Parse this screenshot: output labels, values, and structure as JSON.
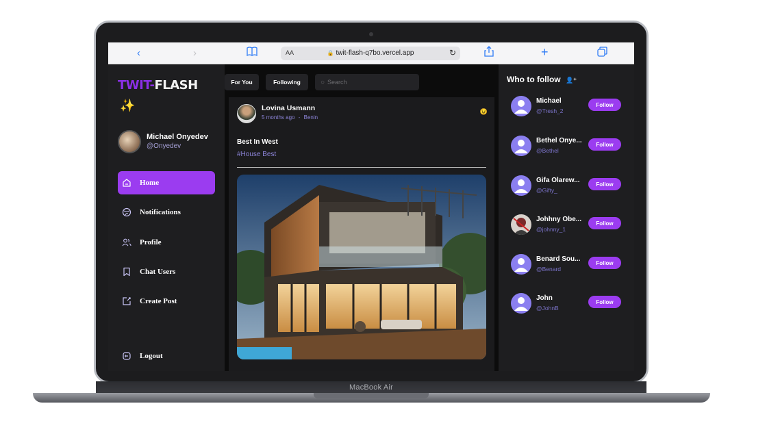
{
  "device": {
    "label": "MacBook Air"
  },
  "browser": {
    "text_size": "AA",
    "url": "twit-flash-q7bo.vercel.app"
  },
  "sidebar": {
    "logo_part1": "TWIT-",
    "logo_part2": "FLASH",
    "sparkle": "✨",
    "profile": {
      "name": "Michael Onyedev",
      "handle": "@Onyedev"
    },
    "nav": [
      {
        "label": "Home",
        "icon": "home-icon",
        "active": true
      },
      {
        "label": "Notifications",
        "icon": "globe-icon"
      },
      {
        "label": "Profile",
        "icon": "users-icon"
      },
      {
        "label": "Chat Users",
        "icon": "bookmark-icon"
      },
      {
        "label": "Create Post",
        "icon": "create-icon"
      }
    ],
    "logout": "Logout"
  },
  "main": {
    "tabs": [
      "For You",
      "Following"
    ],
    "search_placeholder": "Search",
    "post": {
      "author": "Lovina Usmann",
      "time": "5 months ago",
      "location": "Benin",
      "meta_separator": "-",
      "emoji": "😉",
      "text": "Best In West",
      "tag": "#House Best"
    }
  },
  "who_to_follow": {
    "title": "Who to follow",
    "follow_label": "Follow",
    "users": [
      {
        "name": "Michael",
        "handle": "@Tresh_2"
      },
      {
        "name": "Bethel Onye...",
        "handle": "@Bethel"
      },
      {
        "name": "Gifa Olarew...",
        "handle": "@Gifty_"
      },
      {
        "name": "Johhny Obe...",
        "handle": "@johnny_1"
      },
      {
        "name": "Benard Sou...",
        "handle": "@Benard"
      },
      {
        "name": "John",
        "handle": "@JohnB"
      }
    ]
  },
  "colors": {
    "accent": "#9b3cf0",
    "handle": "#7b73c9",
    "sidebar_bg": "#1e1e20",
    "main_bg": "#0c0c0c"
  }
}
